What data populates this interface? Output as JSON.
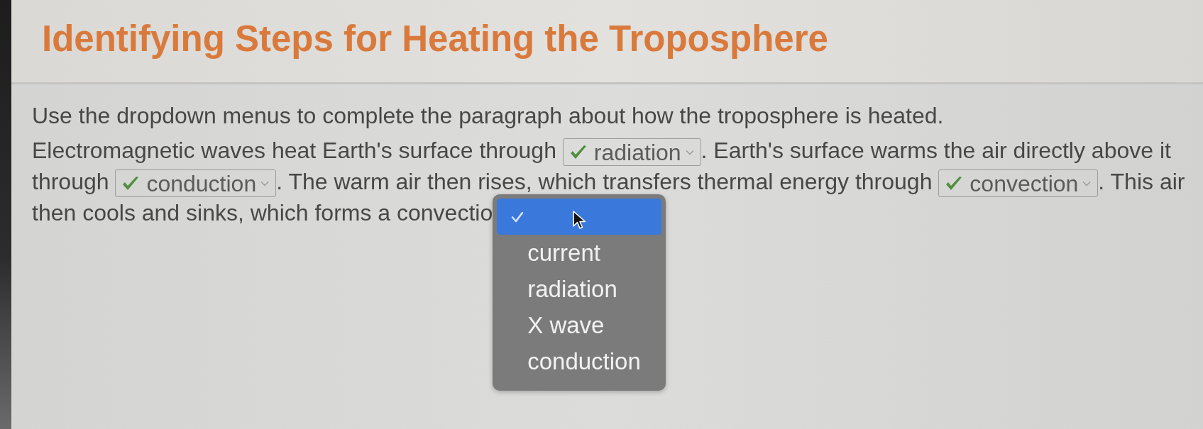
{
  "title": "Identifying Steps for Heating the Troposphere",
  "instructions": "Use the dropdown menus to complete the paragraph about how the troposphere is heated.",
  "paragraph": {
    "lines": [
      [
        {
          "kind": "text",
          "text": "Electromagnetic waves heat Earth's surface through "
        },
        {
          "kind": "dropdown",
          "value": "radiation",
          "correct": true,
          "open": false
        },
        {
          "kind": "text",
          "text": ". Earth's surface warms the air directly above it"
        }
      ],
      [
        {
          "kind": "text",
          "text": "through "
        },
        {
          "kind": "dropdown",
          "value": "conduction",
          "correct": true,
          "open": false
        },
        {
          "kind": "text",
          "text": ". The warm air then rises, which transfers thermal energy through "
        },
        {
          "kind": "dropdown",
          "value": "convection",
          "correct": true,
          "open": false
        },
        {
          "kind": "text",
          "text": ". This air"
        }
      ],
      [
        {
          "kind": "text",
          "text": "then cools and sinks, which forms a convectio"
        },
        {
          "kind": "dropdown",
          "open": true,
          "options": [
            {
              "selected": true,
              "highlighted": true
            },
            {
              "label": "current",
              "selected": false,
              "highlighted": false
            },
            {
              "label": "radiation",
              "selected": false,
              "highlighted": false
            },
            {
              "label": "X wave",
              "selected": false,
              "highlighted": false
            },
            {
              "label": "conduction",
              "selected": false,
              "highlighted": false
            }
          ]
        }
      ]
    ]
  }
}
